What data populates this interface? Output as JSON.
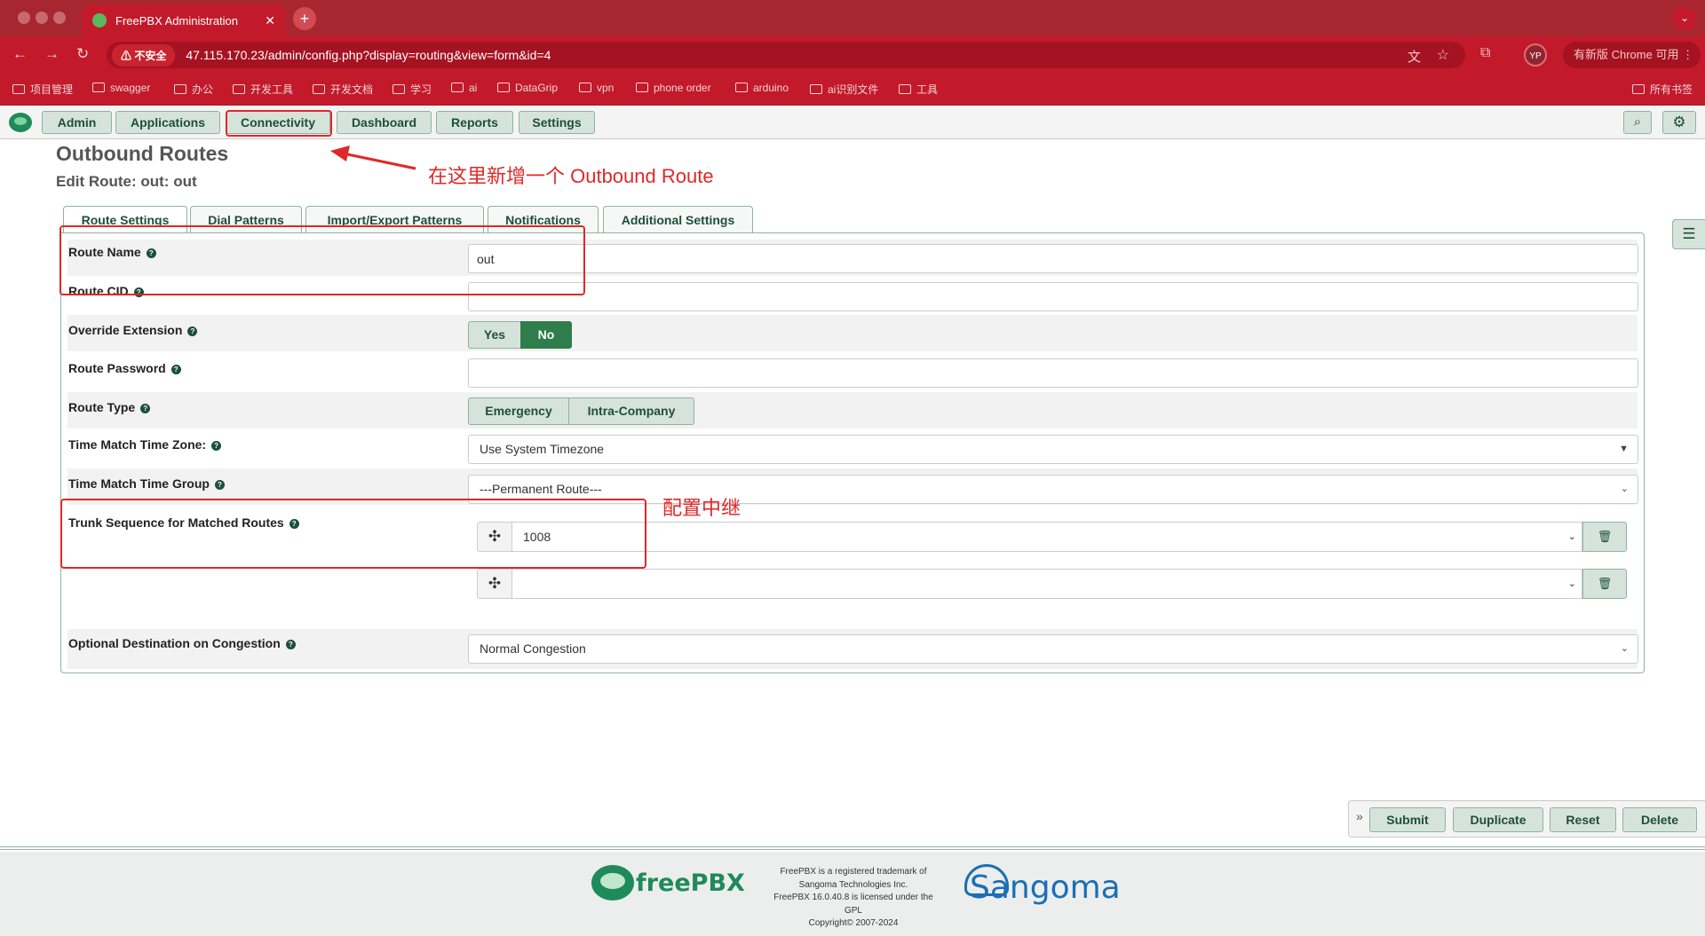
{
  "browser": {
    "tab_title": "FreePBX Administration",
    "tab_close": "✕",
    "new_tab": "+",
    "tab_menu": "⌄",
    "insecure_label": "⚠ 不安全",
    "url": "47.115.170.23/admin/config.php?display=routing&view=form&id=4",
    "profile_initials": "YP",
    "update_chip": "有新版 Chrome 可用",
    "bookmarks": [
      "项目管理",
      "swagger",
      "办公",
      "开发工具",
      "开发文档",
      "学习",
      "ai",
      "DataGrip",
      "vpn",
      "phone order",
      "arduino",
      "ai识别文件",
      "工具"
    ],
    "all_bookmarks": "所有书签"
  },
  "nav": {
    "menus": [
      "Admin",
      "Applications",
      "Connectivity",
      "Dashboard",
      "Reports",
      "Settings"
    ],
    "search_icon": "search-icon",
    "gear_icon": "gear-icon"
  },
  "page": {
    "title": "Outbound Routes",
    "subtitle": "Edit Route: out: out"
  },
  "annotations": {
    "connectivity_note": "在这里新增一个 Outbound Route",
    "trunk_note": "配置中继",
    "color": "#e02828"
  },
  "tabs": [
    "Route Settings",
    "Dial Patterns",
    "Import/Export Patterns",
    "Notifications",
    "Additional Settings"
  ],
  "form": {
    "route_name_label": "Route Name",
    "route_name_value": "out",
    "route_cid_label": "Route CID",
    "route_cid_value": "",
    "override_label": "Override Extension",
    "override_yes": "Yes",
    "override_no": "No",
    "override_selected": "No",
    "password_label": "Route Password",
    "password_value": "",
    "route_type_label": "Route Type",
    "route_type_emergency": "Emergency",
    "route_type_intra": "Intra-Company",
    "timezone_label": "Time Match Time Zone:",
    "timezone_value": "Use System Timezone",
    "time_group_label": "Time Match Time Group",
    "time_group_value": "---Permanent Route---",
    "trunk_label": "Trunk Sequence for Matched Routes",
    "trunks": [
      "1008",
      ""
    ],
    "congestion_label": "Optional Destination on Congestion",
    "congestion_value": "Normal Congestion",
    "help_glyph": "?"
  },
  "actions": {
    "expand": "»",
    "submit": "Submit",
    "duplicate": "Duplicate",
    "reset": "Reset",
    "delete": "Delete"
  },
  "footer": {
    "freepbx_text": "freePBX",
    "legal": [
      "FreePBX is a registered trademark of",
      "Sangoma Technologies Inc.",
      "FreePBX 16.0.40.8 is licensed under the",
      "GPL",
      "Copyright© 2007-2024"
    ],
    "sangoma_text": "Sangoma"
  },
  "colors": {
    "accent_green": "#2f7d4b",
    "button_bg": "#d6e3db",
    "chrome_red": "#c21a2b"
  }
}
